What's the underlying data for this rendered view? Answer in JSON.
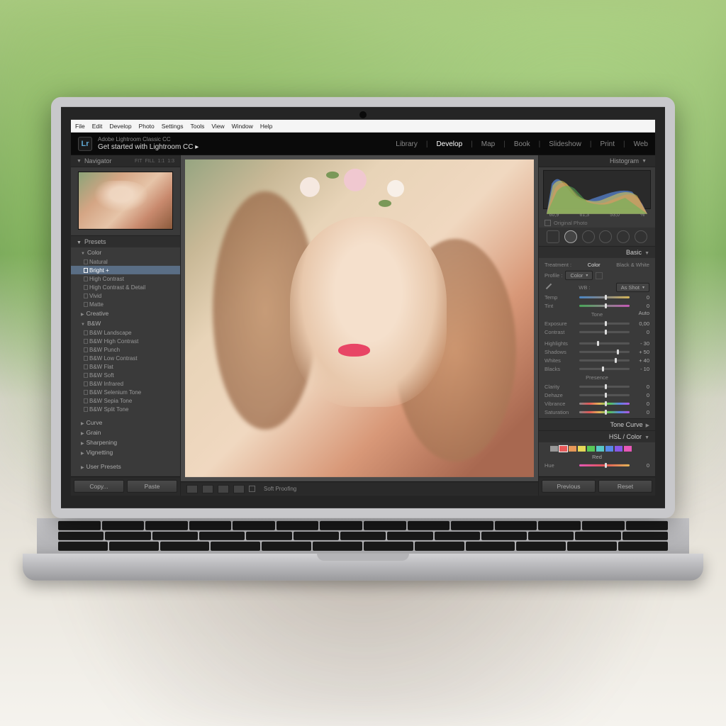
{
  "menubar": [
    "File",
    "Edit",
    "Develop",
    "Photo",
    "Settings",
    "Tools",
    "View",
    "Window",
    "Help"
  ],
  "title": {
    "product": "Adobe Lightroom Classic CC",
    "getstarted": "Get started with Lightroom CC  ▸",
    "logo": "Lr"
  },
  "modules": [
    "Library",
    "Develop",
    "Map",
    "Book",
    "Slideshow",
    "Print",
    "Web"
  ],
  "active_module": "Develop",
  "navigator": {
    "label": "Navigator",
    "opts": [
      "FIT",
      "FILL",
      "1:1",
      "1:3"
    ]
  },
  "presets": {
    "label": "Presets",
    "groups": [
      {
        "name": "Color",
        "items": [
          "Natural",
          "Bright +",
          "High Contrast",
          "High Contrast & Detail",
          "Vivid",
          "Matte"
        ],
        "open": true,
        "selected": "Bright +"
      },
      {
        "name": "Creative",
        "items": [],
        "open": false
      },
      {
        "name": "B&W",
        "items": [
          "B&W Landscape",
          "B&W High Contrast",
          "B&W Punch",
          "B&W Low Contrast",
          "B&W Flat",
          "B&W Soft",
          "B&W Infrared",
          "B&W Selenium Tone",
          "B&W Sepia Tone",
          "B&W Split Tone"
        ],
        "open": true
      }
    ],
    "footer_groups": [
      "Curve",
      "Grain",
      "Sharpening",
      "Vignetting"
    ],
    "user": "User Presets"
  },
  "left_buttons": {
    "copy": "Copy...",
    "paste": "Paste"
  },
  "soft_proof": "Soft Proofing",
  "histogram": {
    "label": "Histogram",
    "vals": [
      "60,9",
      "61,3",
      "53,0",
      "%"
    ],
    "orig": "Original Photo"
  },
  "basic": {
    "label": "Basic",
    "treatment": {
      "label": "Treatment :",
      "color": "Color",
      "bw": "Black & White"
    },
    "profile": {
      "label": "Profile :",
      "value": "Color"
    },
    "wb": {
      "label": "WB :",
      "value": "As Shot"
    },
    "temp": {
      "label": "Temp",
      "val": "0"
    },
    "tint": {
      "label": "Tint",
      "val": "0"
    },
    "tone": {
      "label": "Tone",
      "auto": "Auto"
    },
    "exposure": {
      "label": "Exposure",
      "val": "0,00"
    },
    "contrast": {
      "label": "Contrast",
      "val": "0"
    },
    "highlights": {
      "label": "Highlights",
      "val": "- 30"
    },
    "shadows": {
      "label": "Shadows",
      "val": "+ 50"
    },
    "whites": {
      "label": "Whites",
      "val": "+ 40"
    },
    "blacks": {
      "label": "Blacks",
      "val": "- 10"
    },
    "presence": {
      "label": "Presence"
    },
    "clarity": {
      "label": "Clarity",
      "val": "0"
    },
    "dehaze": {
      "label": "Dehaze",
      "val": "0"
    },
    "vibrance": {
      "label": "Vibrance",
      "val": "0"
    },
    "saturation": {
      "label": "Saturation",
      "val": "0"
    }
  },
  "tonecurve": {
    "label": "Tone Curve"
  },
  "hsl": {
    "label": "HSL / Color",
    "channel": "Red",
    "hue": {
      "label": "Hue",
      "val": "0"
    }
  },
  "right_buttons": {
    "prev": "Previous",
    "reset": "Reset"
  }
}
